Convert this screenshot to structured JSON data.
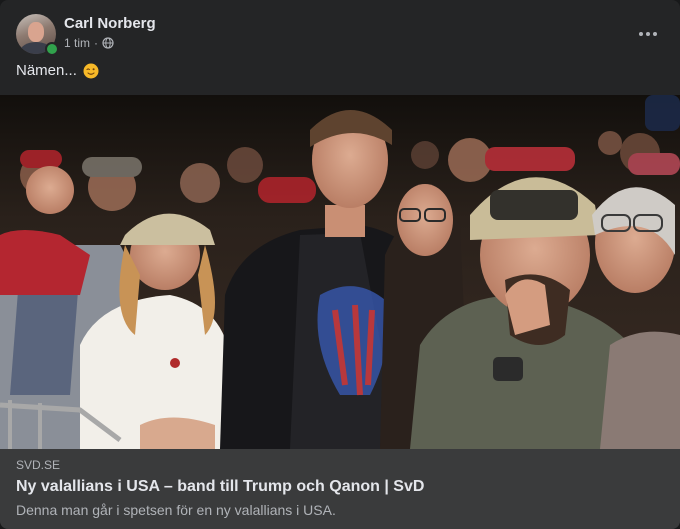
{
  "post": {
    "author": "Carl Norberg",
    "timestamp": "1 tim",
    "separator": "·",
    "audience_icon": "globe-icon",
    "more_icon": "more-options-icon",
    "message": "Nämen...",
    "message_emoji": "winking-face-icon"
  },
  "link_preview": {
    "domain": "SVD.SE",
    "title": "Ny valallians i USA – band till Trump och Qanon | SvD",
    "description": "Denna man går i spetsen för en ny valallians i USA."
  },
  "colors": {
    "card_background": "#242526",
    "link_card_background": "#3a3b3c",
    "primary_text": "#e4e6eb",
    "secondary_text": "#b0b3b8",
    "online_indicator": "#31a24c"
  }
}
